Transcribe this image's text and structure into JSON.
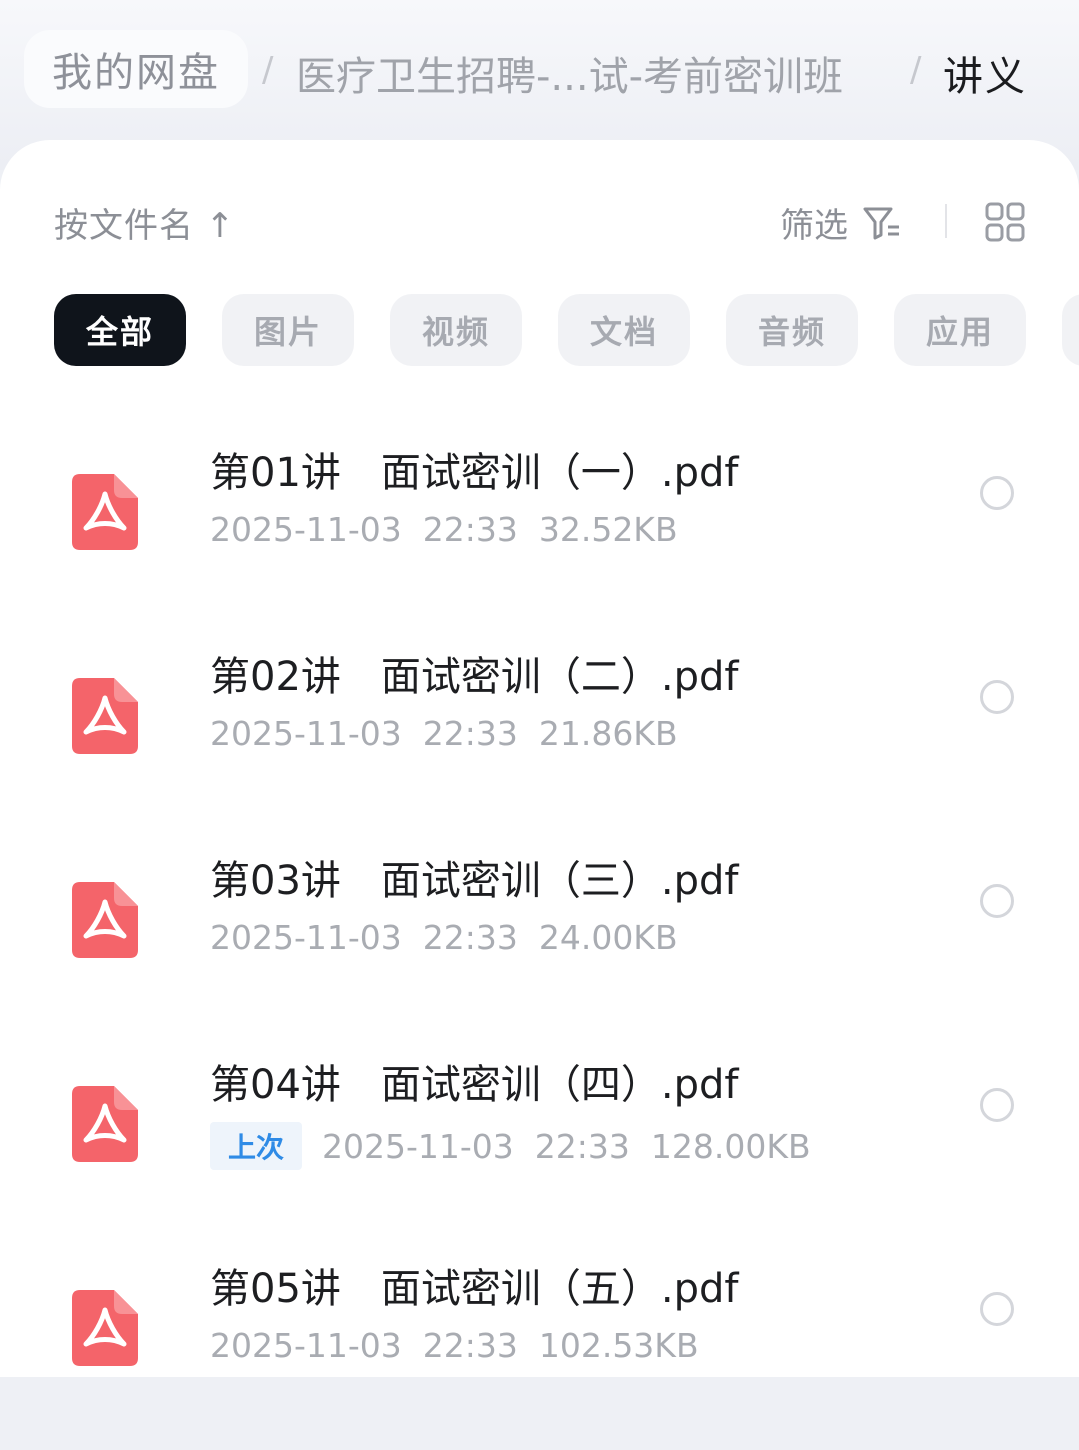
{
  "breadcrumb": {
    "root": "我的网盘",
    "separator": "/",
    "middle": "医疗卫生招聘-...试-考前密训班",
    "current": "讲义"
  },
  "toolbar": {
    "sort_label": "按文件名 ↑",
    "filter_label": "筛选"
  },
  "filters": [
    {
      "label": "全部",
      "active": true
    },
    {
      "label": "图片",
      "active": false
    },
    {
      "label": "视频",
      "active": false
    },
    {
      "label": "文档",
      "active": false
    },
    {
      "label": "音频",
      "active": false
    },
    {
      "label": "应用",
      "active": false
    }
  ],
  "files": [
    {
      "name": "第01讲　面试密训（一）.pdf",
      "meta": "2025-11-03  22:33  32.52KB",
      "tag": "",
      "icon": "pdf-icon"
    },
    {
      "name": "第02讲　面试密训（二）.pdf",
      "meta": "2025-11-03  22:33  21.86KB",
      "tag": "",
      "icon": "pdf-icon"
    },
    {
      "name": "第03讲　面试密训（三）.pdf",
      "meta": "2025-11-03  22:33  24.00KB",
      "tag": "",
      "icon": "pdf-icon"
    },
    {
      "name": "第04讲　面试密训（四）.pdf",
      "meta": "2025-11-03  22:33  128.00KB",
      "tag": "上次",
      "icon": "pdf-icon"
    },
    {
      "name": "第05讲　面试密训（五）.pdf",
      "meta": "2025-11-03  22:33  102.53KB",
      "tag": "",
      "icon": "pdf-icon"
    }
  ],
  "colors": {
    "pdf_icon": "#f4646a",
    "active_chip": "#0f141b",
    "tag_text": "#2f8be6"
  }
}
